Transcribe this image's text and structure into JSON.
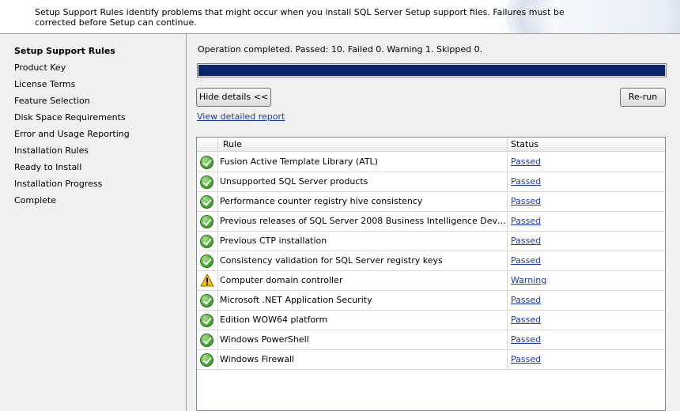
{
  "header": {
    "description": "Setup Support Rules identify problems that might occur when you install SQL Server Setup support files. Failures must be corrected before Setup can continue."
  },
  "sidebar": {
    "items": [
      {
        "label": "Setup Support Rules",
        "active": true
      },
      {
        "label": "Product Key",
        "active": false
      },
      {
        "label": "License Terms",
        "active": false
      },
      {
        "label": "Feature Selection",
        "active": false
      },
      {
        "label": "Disk Space Requirements",
        "active": false
      },
      {
        "label": "Error and Usage Reporting",
        "active": false
      },
      {
        "label": "Installation Rules",
        "active": false
      },
      {
        "label": "Ready to Install",
        "active": false
      },
      {
        "label": "Installation Progress",
        "active": false
      },
      {
        "label": "Complete",
        "active": false
      }
    ]
  },
  "main": {
    "status_line": "Operation completed. Passed: 10.   Failed 0.   Warning 1.   Skipped 0.",
    "progress_fraction": 1.0,
    "hide_details_label": "Hide details <<",
    "rerun_label": "Re-run",
    "view_report_label": "View detailed report",
    "table": {
      "columns": [
        "Rule",
        "Status"
      ],
      "rows": [
        {
          "icon": "success-check-icon",
          "rule": "Fusion Active Template Library (ATL)",
          "status": "Passed"
        },
        {
          "icon": "success-check-icon",
          "rule": "Unsupported SQL Server products",
          "status": "Passed"
        },
        {
          "icon": "success-check-icon",
          "rule": "Performance counter registry hive consistency",
          "status": "Passed"
        },
        {
          "icon": "success-check-icon",
          "rule": "Previous releases of SQL Server 2008 Business Intelligence Develop...",
          "status": "Passed"
        },
        {
          "icon": "success-check-icon",
          "rule": "Previous CTP installation",
          "status": "Passed"
        },
        {
          "icon": "success-check-icon",
          "rule": "Consistency validation for SQL Server registry keys",
          "status": "Passed"
        },
        {
          "icon": "warning-triangle-icon",
          "rule": "Computer domain controller",
          "status": "Warning"
        },
        {
          "icon": "success-check-icon",
          "rule": "Microsoft .NET Application Security",
          "status": "Passed"
        },
        {
          "icon": "success-check-icon",
          "rule": "Edition WOW64 platform",
          "status": "Passed"
        },
        {
          "icon": "success-check-icon",
          "rule": "Windows PowerShell",
          "status": "Passed"
        },
        {
          "icon": "success-check-icon",
          "rule": "Windows Firewall",
          "status": "Passed"
        }
      ]
    }
  },
  "colors": {
    "progress_fill": "#0a246a",
    "link": "#1a3aa8",
    "success": "#4fae3a",
    "warning": "#f5c400"
  }
}
